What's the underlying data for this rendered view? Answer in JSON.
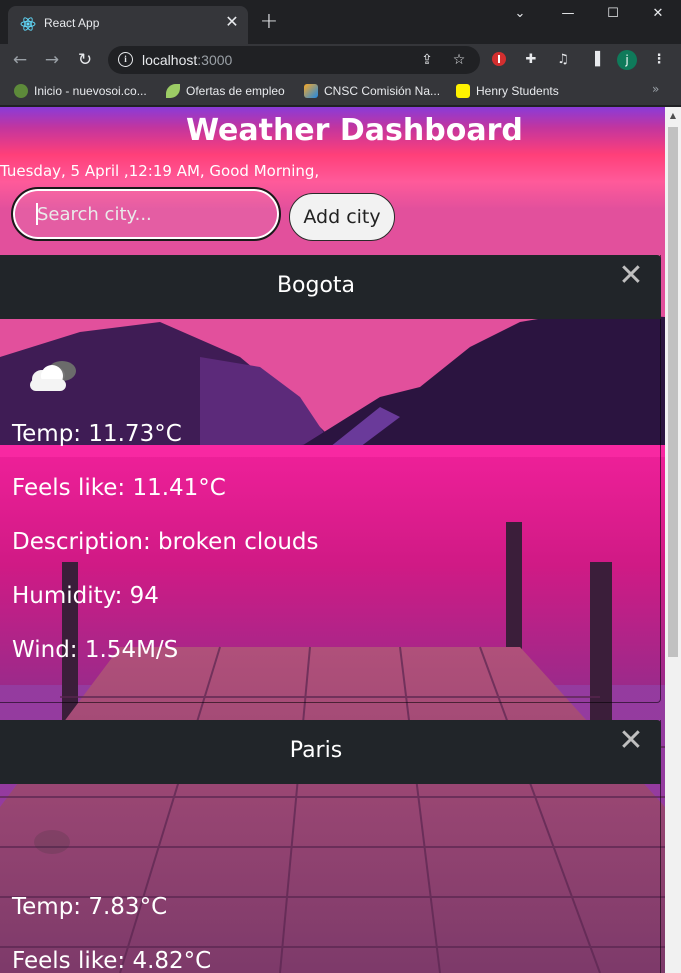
{
  "browser": {
    "tab_title": "React App",
    "tab_close": "✕",
    "new_tab": "+",
    "url_host": "localhost",
    "url_port": ":3000",
    "profile_initial": "j",
    "bookmarks": [
      {
        "label": "Inicio - nuevosoi.co...",
        "icon": "leaf-icon",
        "color": "#7cb342"
      },
      {
        "label": "Ofertas de empleo",
        "icon": "lime-leaf-icon",
        "color": "#9ccc65"
      },
      {
        "label": "CNSC Comisión Na...",
        "icon": "cnsc-icon",
        "color": "#f9a825"
      },
      {
        "label": "Henry Students",
        "icon": "henry-icon",
        "color": "#fff200"
      }
    ],
    "bookmarks_more": "»"
  },
  "app": {
    "title": "Weather Dashboard",
    "greeting": "Tuesday, 5 April ,12:19 AM, Good Morning,",
    "search_placeholder": "Search city...",
    "add_button": "Add city"
  },
  "cards": [
    {
      "city": "Bogota",
      "close": "✕",
      "icon": "broken-clouds-icon",
      "temp": "Temp: 11.73°C",
      "feels_like": "Feels like: 11.41°C",
      "description": "Description: broken clouds",
      "humidity": "Humidity: 94",
      "wind": "Wind: 1.54M/S"
    },
    {
      "city": "Paris",
      "close": "✕",
      "icon": "weather-icon",
      "temp": "Temp: 7.83°C",
      "feels_like": "Feels like: 4.82°C"
    }
  ],
  "colors": {
    "card_header": "#212529",
    "browser_dark": "#202124",
    "browser_toolbar": "#35363a"
  }
}
